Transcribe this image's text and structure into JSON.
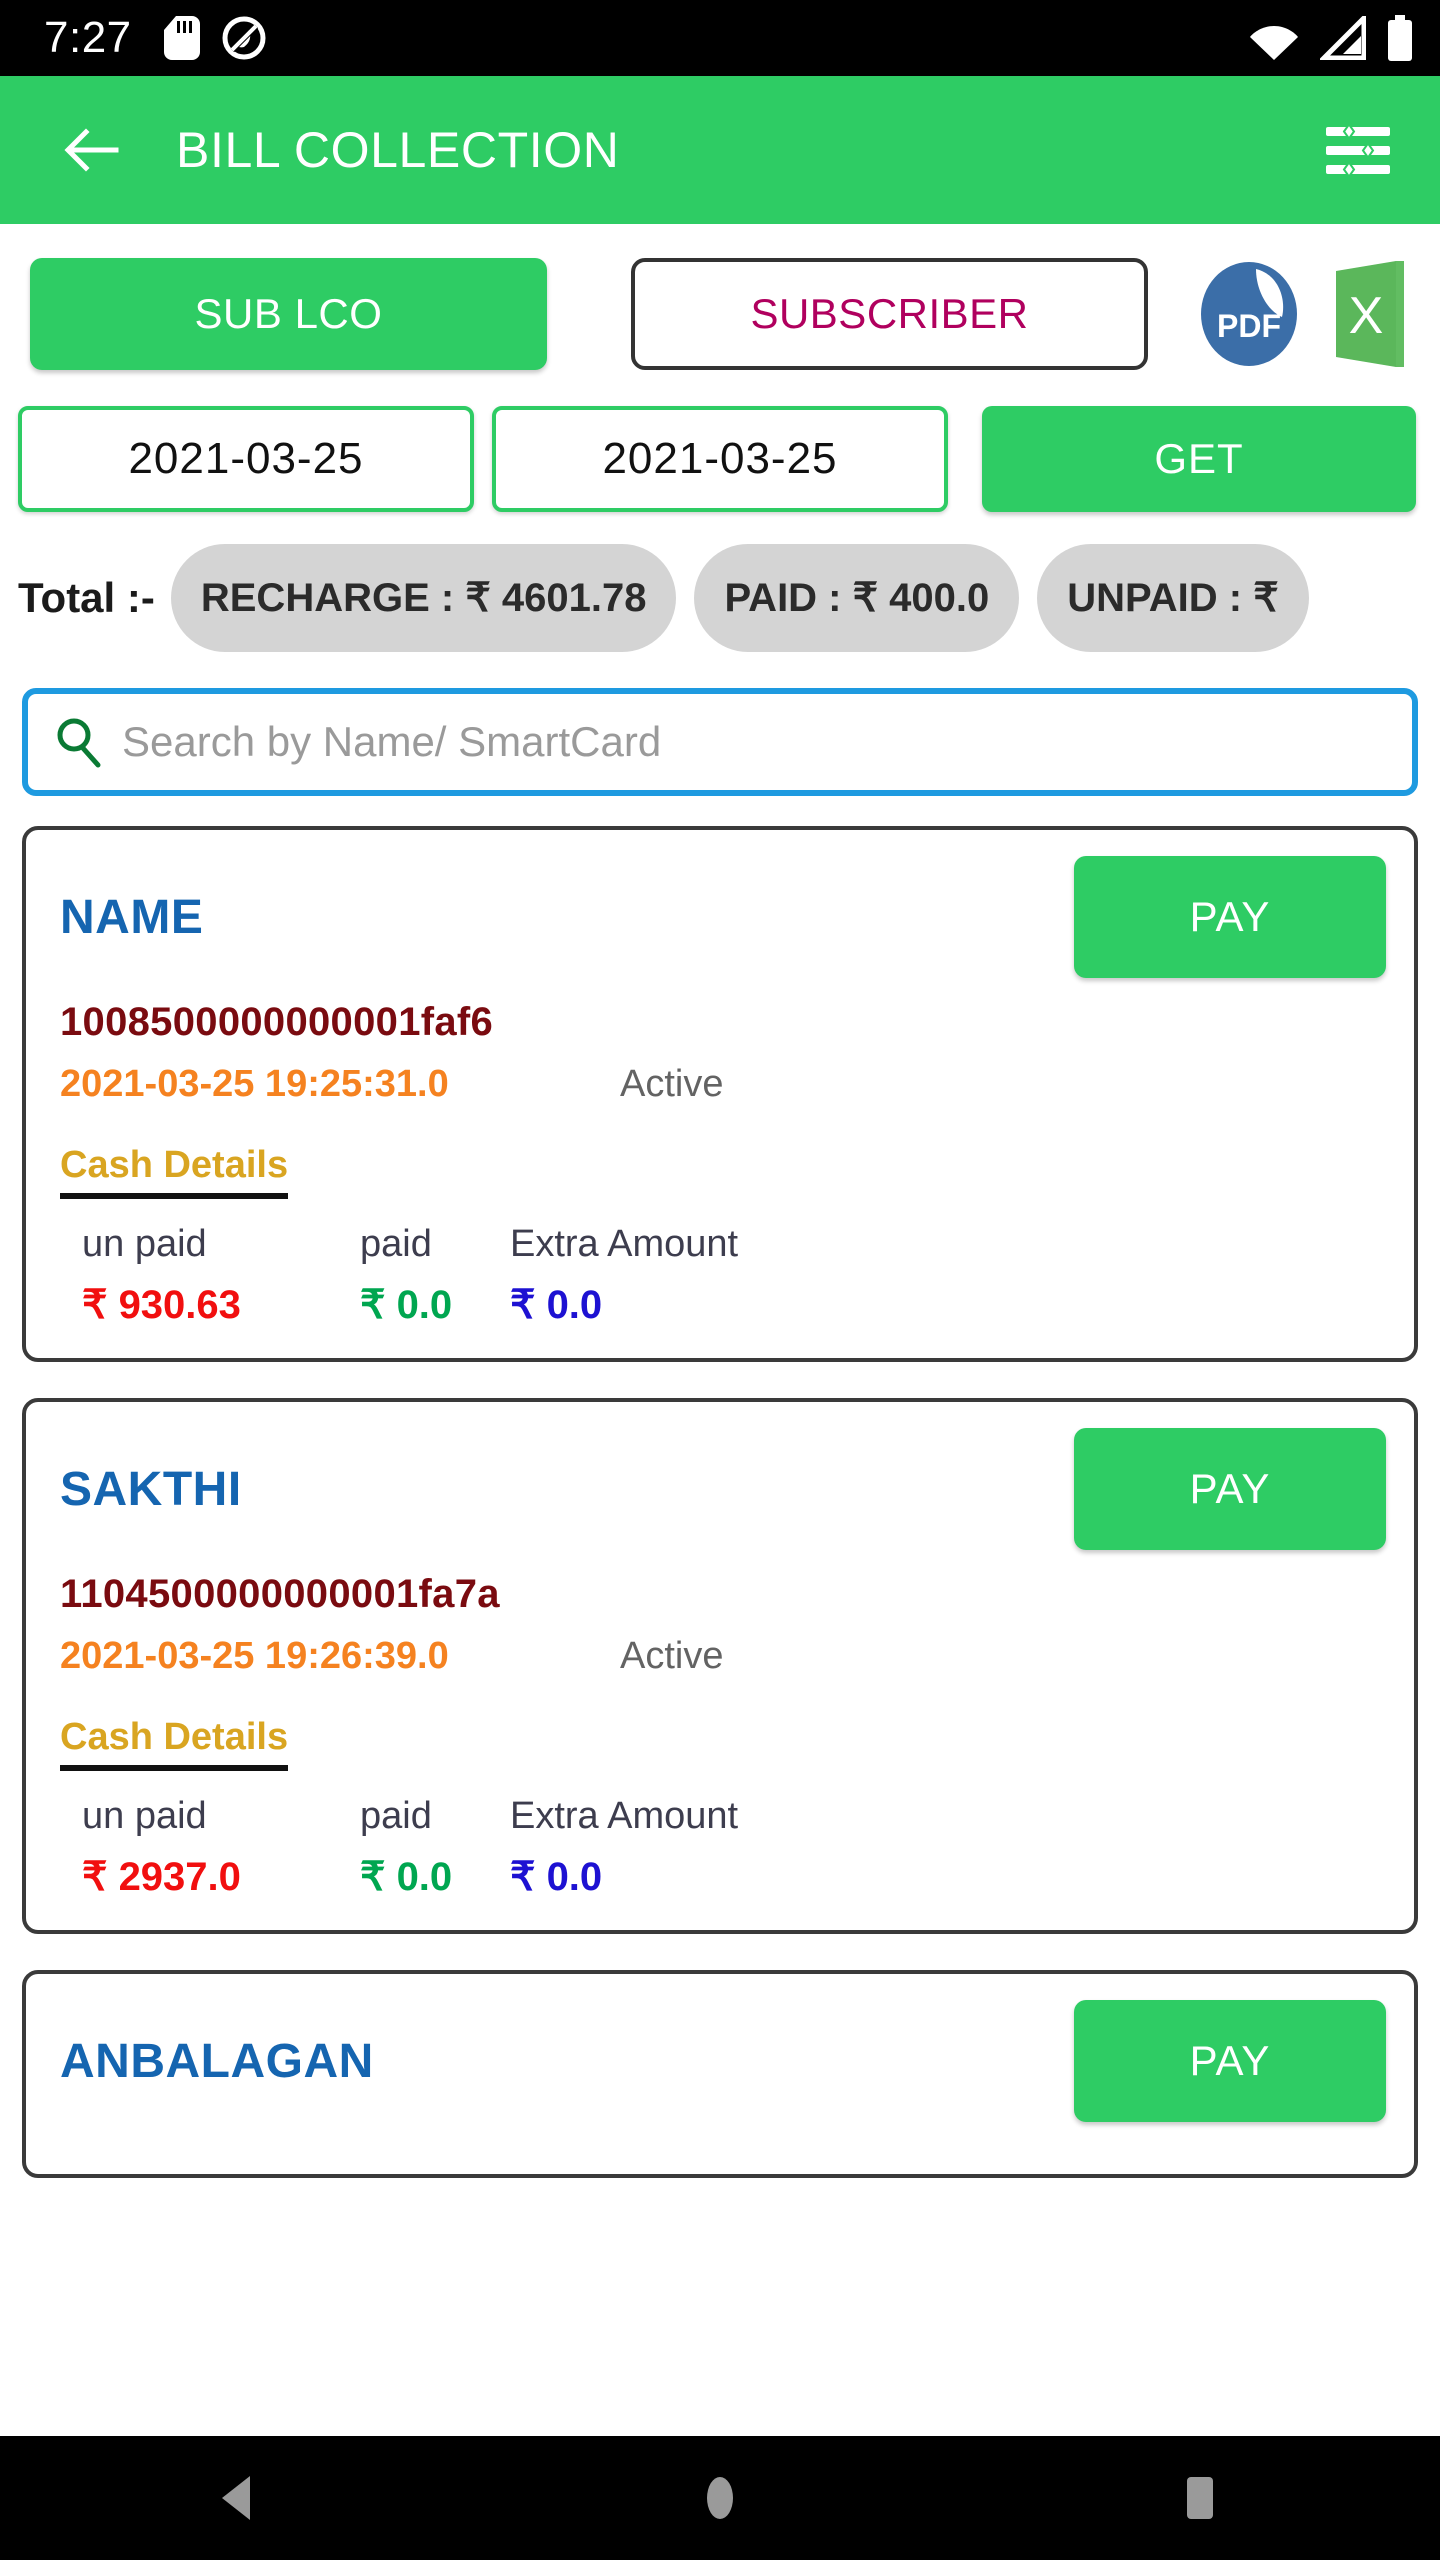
{
  "status_bar": {
    "clock": "7:27",
    "icons": [
      "sdcard-icon",
      "android-q-icon",
      "wifi-icon",
      "cellular-signal-icon",
      "battery-icon"
    ]
  },
  "app_bar": {
    "back_label": "back-arrow",
    "title": "BILL COLLECTION",
    "filter_label": "tune-filter"
  },
  "segment": {
    "sub_lco_label": "SUB LCO",
    "subscriber_label": "SUBSCRIBER",
    "pdf_label": "PDF",
    "excel_label": "X"
  },
  "date_filter": {
    "from_date": "2021-03-25",
    "to_date": "2021-03-25",
    "get_label": "GET"
  },
  "totals": {
    "label": "Total :-",
    "chips": [
      "RECHARGE  : ₹ 4601.78",
      "PAID  : ₹ 400.0",
      "UNPAID  : ₹"
    ]
  },
  "search": {
    "placeholder": "Search by Name/ SmartCard",
    "value": ""
  },
  "labels": {
    "cash_details": "Cash Details",
    "unpaid_head": "un paid",
    "paid_head": "paid",
    "extra_head": "Extra Amount",
    "pay_label": "PAY"
  },
  "cards": [
    {
      "name": "NAME",
      "smartcard": "1008500000000001faf6",
      "datetime": "2021-03-25 19:25:31.0",
      "status": "Active",
      "unpaid": "₹  930.63",
      "paid": "₹ 0.0",
      "extra": "₹  0.0"
    },
    {
      "name": "SAKTHI",
      "smartcard": "1104500000000001fa7a",
      "datetime": "2021-03-25 19:26:39.0",
      "status": "Active",
      "unpaid": "₹  2937.0",
      "paid": "₹ 0.0",
      "extra": "₹  0.0"
    },
    {
      "name": "ANBALAGAN",
      "smartcard": "",
      "datetime": "",
      "status": "",
      "unpaid": "",
      "paid": "",
      "extra": ""
    }
  ],
  "nav_bar": {
    "back": "nav-back",
    "home": "nav-home",
    "recents": "nav-recents"
  },
  "colors": {
    "primary_green": "#2ecc64",
    "magenta": "#b0005e",
    "name_blue": "#1565b0",
    "smartcard_maroon": "#7a0b10",
    "date_orange": "#f58220",
    "cash_gold": "#d9a521",
    "unpaid_red": "#f10f0f",
    "paid_green": "#00a650",
    "extra_blue": "#1d11d2",
    "search_border_blue": "#1e9ae0",
    "chip_gray": "#d4d4d4"
  }
}
